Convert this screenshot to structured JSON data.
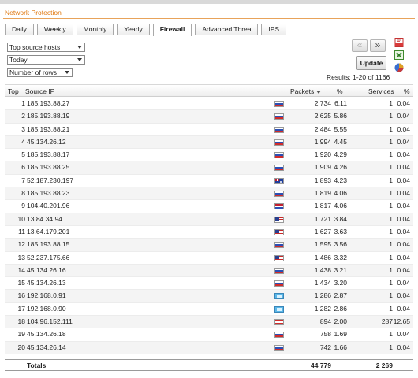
{
  "window": {
    "title": "Network Protection"
  },
  "tabs": [
    {
      "label": "Daily",
      "active": false
    },
    {
      "label": "Weekly",
      "active": false
    },
    {
      "label": "Monthly",
      "active": false
    },
    {
      "label": "Yearly",
      "active": false
    },
    {
      "label": "Firewall",
      "active": true
    },
    {
      "label": "Advanced Threa...",
      "active": false
    },
    {
      "label": "IPS",
      "active": false
    }
  ],
  "filters": {
    "report_type": "Top source hosts",
    "period": "Today",
    "rows": "Number of rows"
  },
  "pager": {
    "prev": "«",
    "next": "»",
    "update_label": "Update",
    "results": "Results: 1-20 of 1166"
  },
  "export_icons": [
    "pdf-export-icon",
    "excel-export-icon",
    "chart-icon"
  ],
  "table": {
    "headers": {
      "top": "Top",
      "source_ip": "Source IP",
      "packets": "Packets",
      "pct": "%",
      "services": "Services",
      "pct2": "%"
    },
    "rows": [
      {
        "top": "1",
        "ip": "185.193.88.27",
        "flag": "ru",
        "packets": "2 734",
        "pct": "6.11",
        "services": "1",
        "spct": "0.04"
      },
      {
        "top": "2",
        "ip": "185.193.88.19",
        "flag": "ru",
        "packets": "2 625",
        "pct": "5.86",
        "services": "1",
        "spct": "0.04"
      },
      {
        "top": "3",
        "ip": "185.193.88.21",
        "flag": "ru",
        "packets": "2 484",
        "pct": "5.55",
        "services": "1",
        "spct": "0.04"
      },
      {
        "top": "4",
        "ip": "45.134.26.12",
        "flag": "ru",
        "packets": "1 994",
        "pct": "4.45",
        "services": "1",
        "spct": "0.04"
      },
      {
        "top": "5",
        "ip": "185.193.88.17",
        "flag": "ru",
        "packets": "1 920",
        "pct": "4.29",
        "services": "1",
        "spct": "0.04"
      },
      {
        "top": "6",
        "ip": "185.193.88.25",
        "flag": "ru",
        "packets": "1 909",
        "pct": "4.26",
        "services": "1",
        "spct": "0.04"
      },
      {
        "top": "7",
        "ip": "52.187.230.197",
        "flag": "au",
        "packets": "1 893",
        "pct": "4.23",
        "services": "1",
        "spct": "0.04"
      },
      {
        "top": "8",
        "ip": "185.193.88.23",
        "flag": "ru",
        "packets": "1 819",
        "pct": "4.06",
        "services": "1",
        "spct": "0.04"
      },
      {
        "top": "9",
        "ip": "104.40.201.96",
        "flag": "nl",
        "packets": "1 817",
        "pct": "4.06",
        "services": "1",
        "spct": "0.04"
      },
      {
        "top": "10",
        "ip": "13.84.34.94",
        "flag": "us",
        "packets": "1 721",
        "pct": "3.84",
        "services": "1",
        "spct": "0.04"
      },
      {
        "top": "11",
        "ip": "13.64.179.201",
        "flag": "us",
        "packets": "1 627",
        "pct": "3.63",
        "services": "1",
        "spct": "0.04"
      },
      {
        "top": "12",
        "ip": "185.193.88.15",
        "flag": "ru",
        "packets": "1 595",
        "pct": "3.56",
        "services": "1",
        "spct": "0.04"
      },
      {
        "top": "13",
        "ip": "52.237.175.66",
        "flag": "us",
        "packets": "1 486",
        "pct": "3.32",
        "services": "1",
        "spct": "0.04"
      },
      {
        "top": "14",
        "ip": "45.134.26.16",
        "flag": "ru",
        "packets": "1 438",
        "pct": "3.21",
        "services": "1",
        "spct": "0.04"
      },
      {
        "top": "15",
        "ip": "45.134.26.13",
        "flag": "ru",
        "packets": "1 434",
        "pct": "3.20",
        "services": "1",
        "spct": "0.04"
      },
      {
        "top": "16",
        "ip": "192.168.0.91",
        "flag": "lan",
        "packets": "1 286",
        "pct": "2.87",
        "services": "1",
        "spct": "0.04"
      },
      {
        "top": "17",
        "ip": "192.168.0.90",
        "flag": "lan",
        "packets": "1 282",
        "pct": "2.86",
        "services": "1",
        "spct": "0.04"
      },
      {
        "top": "18",
        "ip": "104.96.152.111",
        "flag": "at",
        "packets": "894",
        "pct": "2.00",
        "services": "287",
        "spct": "12.65"
      },
      {
        "top": "19",
        "ip": "45.134.26.18",
        "flag": "ru",
        "packets": "758",
        "pct": "1.69",
        "services": "1",
        "spct": "0.04"
      },
      {
        "top": "20",
        "ip": "45.134.26.14",
        "flag": "ru",
        "packets": "742",
        "pct": "1.66",
        "services": "1",
        "spct": "0.04"
      }
    ],
    "totals": {
      "label": "Totals",
      "packets": "44 779",
      "services": "2 269"
    }
  }
}
